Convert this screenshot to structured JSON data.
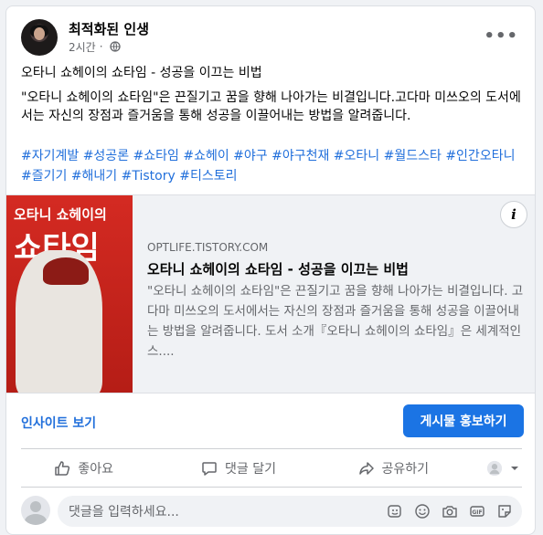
{
  "post": {
    "author": "최적화된 인생",
    "time": "2시간",
    "title_line": "오타니 쇼헤이의 쇼타임 - 성공을 이끄는 비법",
    "body": "\"오타니 쇼헤이의 쇼타임\"은 끈질기고 꿈을 향해 나아가는 비결입니다.고다마 미쓰오의 도서에서는 자신의 장점과 즐거움을 통해 성공을 이끌어내는 방법을 알려줍니다.",
    "hashtags": "#자기계발 #성공론 #쇼타임 #쇼헤이 #야구 #야구천재 #오타니 #월드스타 #인간오타니 #즐기기 #해내기 #Tistory #티스토리"
  },
  "link": {
    "book_title_line1": "오타니 쇼헤이의",
    "book_title_line2": "쇼타임",
    "domain": "OPTLIFE.TISTORY.COM",
    "title": "오타니 쇼헤이의 쇼타임 - 성공을 이끄는 비법",
    "description": "\"오타니 쇼헤이의 쇼타임\"은 끈질기고 꿈을 향해 나아가는 비결입니다. 고다마 미쓰오의 도서에서는 자신의 장점과 즐거움을 통해 성공을 이끌어내는 방법을 알려줍니다. 도서 소개『오타니 쇼헤이의 쇼타임』은 세계적인 스....",
    "info_glyph": "i"
  },
  "insights": {
    "label": "인사이트 보기",
    "promote_label": "게시물 홍보하기"
  },
  "actions": {
    "like": "좋아요",
    "comment": "댓글 달기",
    "share": "공유하기"
  },
  "comment": {
    "placeholder": "댓글을 입력하세요..."
  },
  "colors": {
    "accent": "#1b74e4",
    "link": "#216fdb",
    "muted": "#65676b",
    "book_red": "#d42a22"
  },
  "icons": [
    "globe-icon",
    "more-icon",
    "info-icon",
    "like-icon",
    "comment-icon",
    "share-icon",
    "audience-avatar-icon",
    "chevron-down-icon",
    "sticker-icon",
    "emoji-icon",
    "camera-icon",
    "gif-icon",
    "sticker-face-icon"
  ]
}
